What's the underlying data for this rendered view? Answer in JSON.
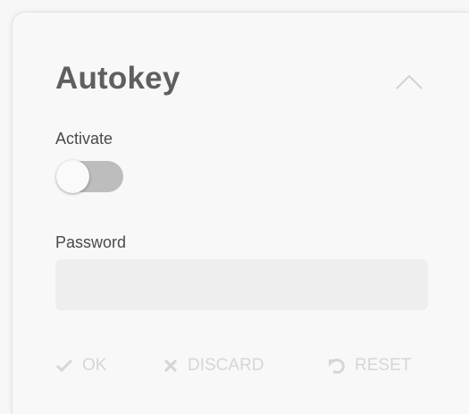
{
  "panel": {
    "title": "Autokey"
  },
  "activate": {
    "label": "Activate",
    "enabled": false
  },
  "password": {
    "label": "Password",
    "value": "",
    "placeholder": ""
  },
  "actions": {
    "ok_label": "OK",
    "discard_label": "DISCARD",
    "reset_label": "RESET"
  },
  "icons": {
    "collapse": "chevron-up-icon",
    "ok": "check-icon",
    "discard": "close-icon",
    "reset": "undo-icon"
  },
  "colors": {
    "title": "#5f5f5f",
    "toggle_track": "#bdbdbd",
    "disabled_action": "#d6d6d6",
    "input_background": "#eeeeee"
  }
}
